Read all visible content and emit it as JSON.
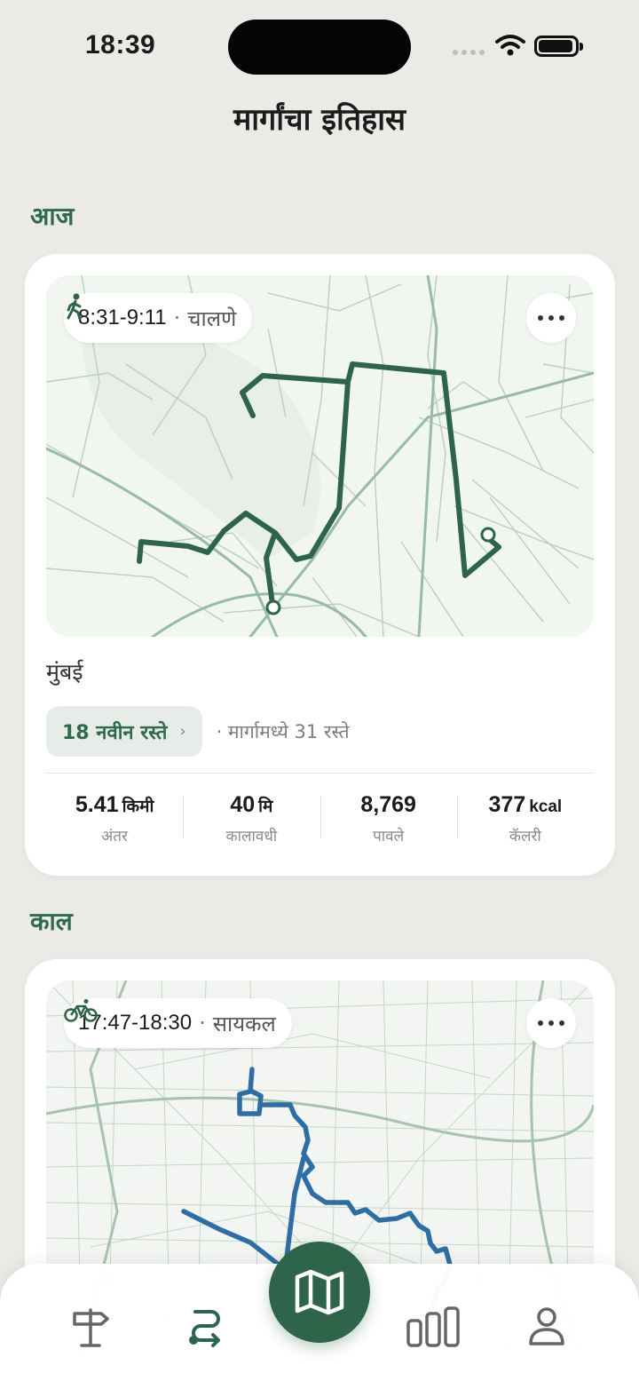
{
  "status_bar": {
    "time": "18:39"
  },
  "page": {
    "title": "मार्गांचा इतिहास"
  },
  "sections": [
    {
      "label": "आज",
      "activity": {
        "icon": "walking-icon",
        "time_range": "8:31-9:11",
        "separator": "·",
        "type": "चालणे",
        "route_color": "#2e6449",
        "city": "मुंबई",
        "new_roads": "18 नवीन रस्ते",
        "total_roads": "मार्गामध्ये 31 रस्ते",
        "stats": [
          {
            "value": "5.41",
            "unit": "किमी",
            "label": "अंतर"
          },
          {
            "value": "40",
            "unit": "मि",
            "label": "कालावधी"
          },
          {
            "value": "8,769",
            "unit": "",
            "label": "पावले"
          },
          {
            "value": "377",
            "unit": "kcal",
            "label": "कॅलरी"
          }
        ]
      }
    },
    {
      "label": "काल",
      "activity": {
        "icon": "bicycle-icon",
        "time_range": "17:47-18:30",
        "separator": "·",
        "type": "सायकल",
        "route_color": "#2f6ea3"
      }
    }
  ],
  "tabbar": {
    "tabs": [
      "signpost-icon",
      "routes-icon",
      "map-icon",
      "stats-icon",
      "profile-icon"
    ],
    "active": "map-icon",
    "accent": "#2e6449"
  }
}
